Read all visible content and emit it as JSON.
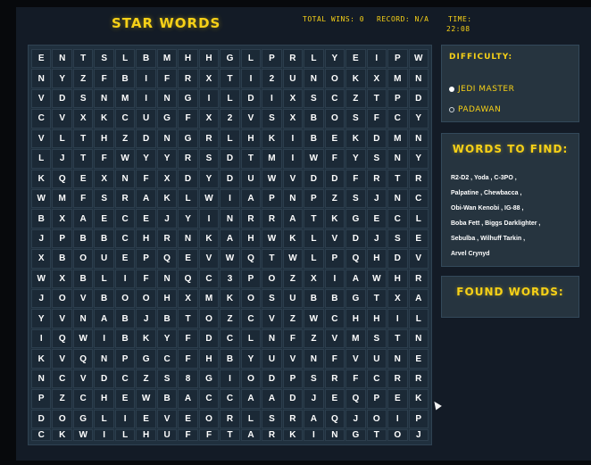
{
  "header": {
    "title": "STAR WORDS",
    "total_wins": "TOTAL WINS: 0",
    "record": "RECORD: N/A",
    "time_label": "TIME:",
    "time_value": "22:08"
  },
  "grid": [
    "ENTSLBMHHGLPRLYEIPW",
    "NYZFBIFRXTI2UNOKXMN",
    "VDSNMINGILDIXSCZTPD",
    "CVXKCUGFX2VSXBOSFCY",
    "VLTHZDNGRLHKIBEKDMN",
    "LJTFWYYRSDTMIWFYSNY",
    "KQEXNFXDYDUWVDDFRTR",
    "WMFSRAKLWIAPNPZSJNC",
    "BXAECEJYINRRATKGECL",
    "JPBBCHRNKAHWKLVDJSE",
    "XBOUEPQEVWQTWLPQHDV",
    "WXBLIFNQC3POZXIAWHR",
    "JOVBOOHXMKOSUBBGTXA",
    "YVNABJBTOZCVZWCHHIL",
    "IQWIBKYFDCLNFZVMSTN",
    "KVQNPGCFHBYUVNFVUNE",
    "NCVDCZS8GIODPSRFCRR",
    "PZCHEWBACCAADJEQPEK",
    "DOGLIEVEORLSRAQJOIP",
    "CKWILHUFFTARKINGTOJ"
  ],
  "difficulty": {
    "title": "DIFFICULTY:",
    "options": [
      {
        "label": "JEDI MASTER",
        "selected": true
      },
      {
        "label": "PADAWAN",
        "selected": false
      }
    ]
  },
  "words_panel": {
    "title": "WORDS TO FIND:",
    "rows": [
      [
        "R2-D2",
        "Yoda",
        "C-3PO"
      ],
      [
        "Palpatine",
        "Chewbacca"
      ],
      [
        "Obi-Wan Kenobi",
        "IG-88"
      ],
      [
        "Boba Fett",
        "Biggs Darklighter"
      ],
      [
        "Sebulba",
        "Wilhuff Tarkin"
      ],
      [
        "Arvel Crynyd"
      ]
    ]
  },
  "found_panel": {
    "title": "FOUND WORDS:"
  },
  "colors": {
    "accent": "#f7d117",
    "background": "#07090c",
    "panel": "#26343f",
    "grid": "#20303e"
  }
}
